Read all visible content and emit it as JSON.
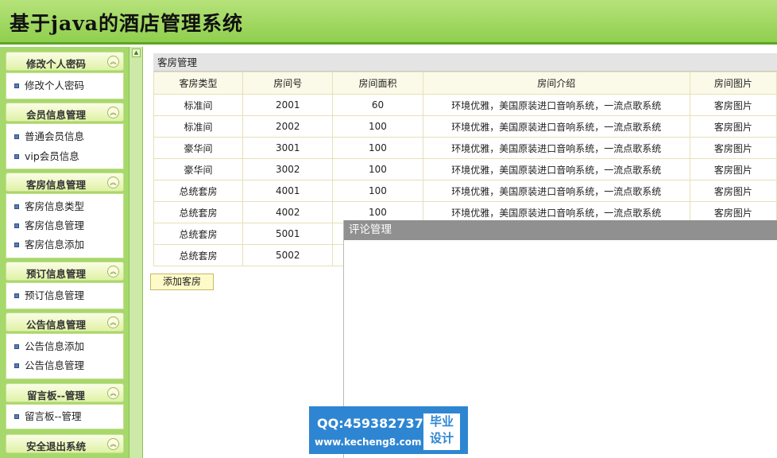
{
  "app": {
    "title": "基于java的酒店管理系统"
  },
  "sidebar": {
    "groups": [
      {
        "label": "修改个人密码",
        "items": [
          "修改个人密码"
        ]
      },
      {
        "label": "会员信息管理",
        "items": [
          "普通会员信息",
          "vip会员信息"
        ]
      },
      {
        "label": "客房信息管理",
        "items": [
          "客房信息类型",
          "客房信息管理",
          "客房信息添加"
        ]
      },
      {
        "label": "预订信息管理",
        "items": [
          "预订信息管理"
        ]
      },
      {
        "label": "公告信息管理",
        "items": [
          "公告信息添加",
          "公告信息管理"
        ]
      },
      {
        "label": "留言板--管理",
        "items": [
          "留言板--管理"
        ]
      },
      {
        "label": "安全退出系统",
        "items": []
      }
    ],
    "toggle_glyph": "︽",
    "splitter_glyph": "▲"
  },
  "main": {
    "panel_title": "客房管理",
    "table": {
      "headers": [
        "客房类型",
        "房间号",
        "房间面积",
        "房间介绍",
        "房间图片"
      ],
      "rows": [
        [
          "标准间",
          "2001",
          "60",
          "环境优雅，美国原装进口音响系统，一流点歌系统",
          "客房图片"
        ],
        [
          "标准间",
          "2002",
          "100",
          "环境优雅，美国原装进口音响系统，一流点歌系统",
          "客房图片"
        ],
        [
          "豪华间",
          "3001",
          "100",
          "环境优雅，美国原装进口音响系统，一流点歌系统",
          "客房图片"
        ],
        [
          "豪华间",
          "3002",
          "100",
          "环境优雅，美国原装进口音响系统，一流点歌系统",
          "客房图片"
        ],
        [
          "总统套房",
          "4001",
          "100",
          "环境优雅，美国原装进口音响系统，一流点歌系统",
          "客房图片"
        ],
        [
          "总统套房",
          "4002",
          "100",
          "环境优雅，美国原装进口音响系统，一流点歌系统",
          "客房图片"
        ],
        [
          "总统套房",
          "5001",
          "",
          "",
          ""
        ],
        [
          "总统套房",
          "5002",
          "",
          "",
          ""
        ]
      ]
    },
    "add_button": "添加客房"
  },
  "comment_panel": {
    "title": "评论管理"
  },
  "watermark": {
    "qq": "QQ:459382737",
    "url": "www.kecheng8.com",
    "badge_line1": "毕业",
    "badge_line2": "设计"
  },
  "colors": {
    "header": "#8fcf4e",
    "sidebar": "#a6d86c",
    "watermark": "#2e86d2"
  }
}
